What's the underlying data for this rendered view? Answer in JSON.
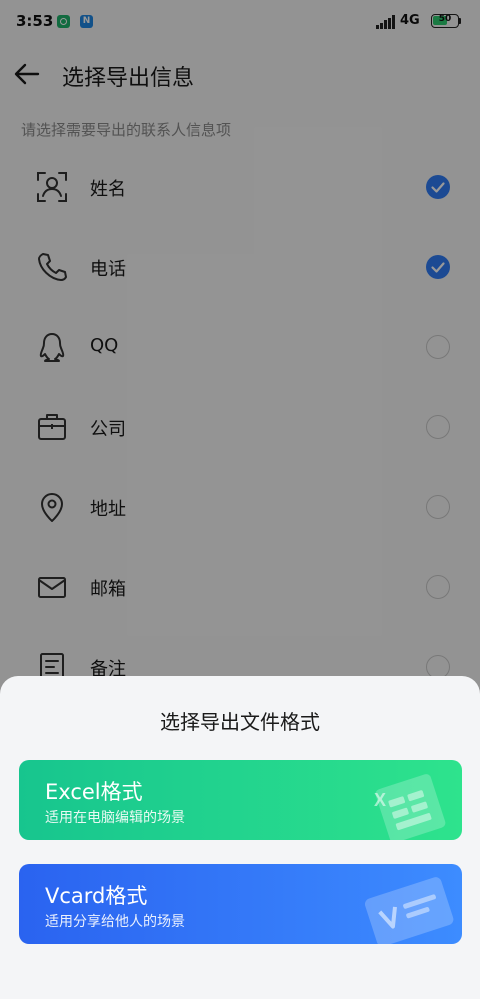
{
  "status_bar": {
    "time": "3:53",
    "app_icon_2_letter": "N",
    "network": "4G",
    "battery": "50"
  },
  "header": {
    "title": "选择导出信息"
  },
  "subtitle": "请选择需要导出的联系人信息项",
  "items": [
    {
      "label": "姓名",
      "icon": "person-icon",
      "checked": true
    },
    {
      "label": "电话",
      "icon": "phone-icon",
      "checked": true
    },
    {
      "label": "QQ",
      "icon": "qq-icon",
      "checked": false
    },
    {
      "label": "公司",
      "icon": "briefcase-icon",
      "checked": false
    },
    {
      "label": "地址",
      "icon": "location-icon",
      "checked": false
    },
    {
      "label": "邮箱",
      "icon": "mail-icon",
      "checked": false
    },
    {
      "label": "备注",
      "icon": "note-icon",
      "checked": false
    }
  ],
  "sheet": {
    "title": "选择导出文件格式",
    "options": [
      {
        "title": "Excel格式",
        "desc": "适用在电脑编辑的场景",
        "icon": "excel-icon"
      },
      {
        "title": "Vcard格式",
        "desc": "适用分享给他人的场景",
        "icon": "vcard-icon"
      }
    ]
  },
  "colors": {
    "accent": "#2f7cf6",
    "excel_start": "#17c58e",
    "excel_end": "#2ee38d",
    "vcard_start": "#2a63f0",
    "vcard_end": "#3d8cff"
  }
}
